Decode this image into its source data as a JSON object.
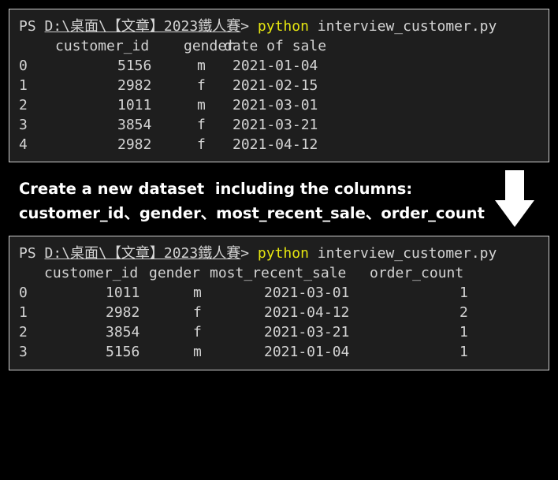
{
  "terminal_1": {
    "prompt_prefix": "PS ",
    "path": "D:\\桌面\\【文章】2023鐵人賽",
    "prompt_suffix": "> ",
    "command": "python",
    "args": " interview_customer.py",
    "headers": [
      "customer_id",
      "gender",
      "date of sale"
    ],
    "rows": [
      {
        "index": "0",
        "customer_id": "5156",
        "gender": "m",
        "date": "2021-01-04"
      },
      {
        "index": "1",
        "customer_id": "2982",
        "gender": "f",
        "date": "2021-02-15"
      },
      {
        "index": "2",
        "customer_id": "1011",
        "gender": "m",
        "date": "2021-03-01"
      },
      {
        "index": "3",
        "customer_id": "3854",
        "gender": "f",
        "date": "2021-03-21"
      },
      {
        "index": "4",
        "customer_id": "2982",
        "gender": "f",
        "date": "2021-04-12"
      }
    ]
  },
  "caption": {
    "line1": "Create a new dataset  including the columns:",
    "line2": "customer_id、gender、most_recent_sale、order_count"
  },
  "arrow_icon": "down-arrow-icon",
  "terminal_2": {
    "prompt_prefix": "PS ",
    "path": "D:\\桌面\\【文章】2023鐵人賽",
    "prompt_suffix": "> ",
    "command": "python",
    "args": " interview_customer.py",
    "headers": [
      "customer_id",
      "gender",
      "most_recent_sale",
      "order_count"
    ],
    "rows": [
      {
        "index": "0",
        "customer_id": "1011",
        "gender": "m",
        "most_recent_sale": "2021-03-01",
        "order_count": "1"
      },
      {
        "index": "1",
        "customer_id": "2982",
        "gender": "f",
        "most_recent_sale": "2021-04-12",
        "order_count": "2"
      },
      {
        "index": "2",
        "customer_id": "3854",
        "gender": "f",
        "most_recent_sale": "2021-03-21",
        "order_count": "1"
      },
      {
        "index": "3",
        "customer_id": "5156",
        "gender": "m",
        "most_recent_sale": "2021-01-04",
        "order_count": "1"
      }
    ]
  },
  "colors": {
    "terminal_bg": "#1e1e1e",
    "terminal_text": "#d4d4d4",
    "command_yellow": "#e5e510",
    "page_bg": "#000000",
    "caption_text": "#ffffff"
  }
}
